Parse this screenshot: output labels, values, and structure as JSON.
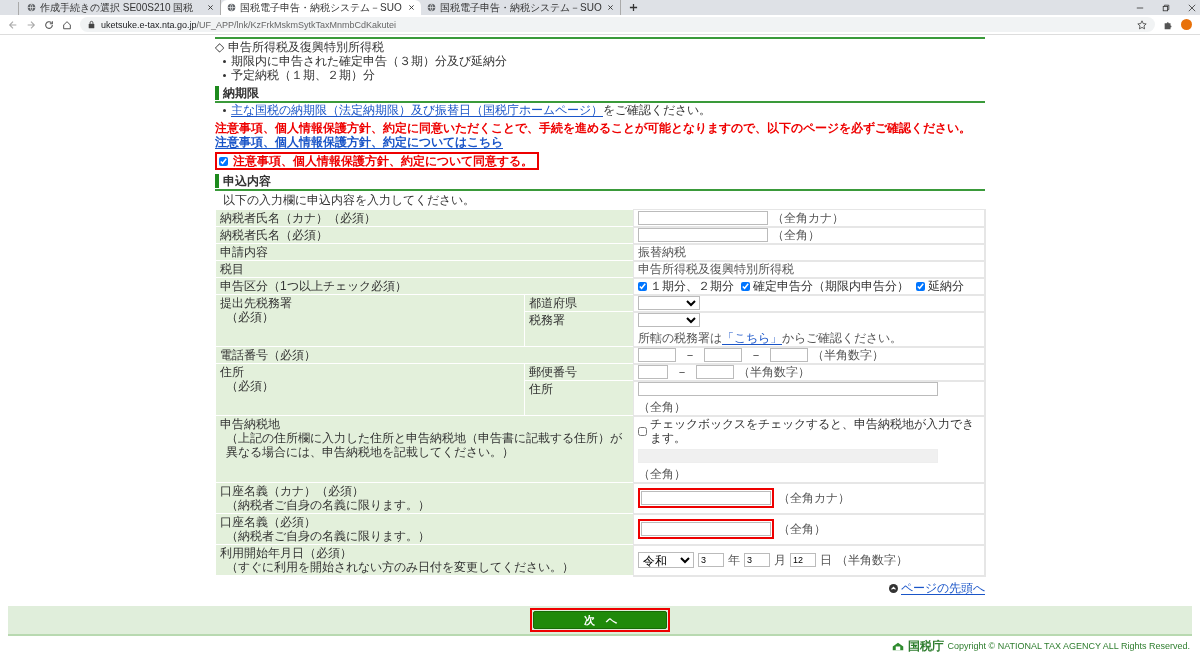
{
  "browser": {
    "tabs": [
      {
        "title": "作成手続きの選択 SE00S210 国税",
        "selected": false
      },
      {
        "title": "国税電子申告・納税システム－SUO",
        "selected": true
      },
      {
        "title": "国税電子申告・納税システム－SUO",
        "selected": false
      }
    ],
    "url": {
      "host": "uketsuke.e-tax.nta.go.jp",
      "path": "/UF_APP/lnk/KzFrkMskmSytkTaxMnmbCdKakutei"
    }
  },
  "tax_item": {
    "title": "◇ 申告所得税及復興特別所得税",
    "bullets": [
      "期限内に申告された確定申告（３期）分及び延納分",
      "予定納税（１期、２期）分"
    ]
  },
  "deadline": {
    "heading": "納期限",
    "link": "主な国税の納期限（法定納期限）及び振替日（国税庁ホームページ）",
    "after": "をご確認ください。"
  },
  "notice": {
    "text": "注意事項、個人情報保護方針、約定に同意いただくことで、手続を進めることが可能となりますので、以下のページを必ずご確認ください。",
    "link": "注意事項、個人情報保護方針、約定についてはこちら"
  },
  "agree": {
    "label": "注意事項、個人情報保護方針、約定について同意する。",
    "checked": true,
    "highlighted": true
  },
  "form": {
    "heading": "申込内容",
    "intro": "以下の入力欄に申込内容を入力してください。",
    "rows": [
      {
        "label": "納税者氏名（カナ）（必須）",
        "parts": [
          {
            "items": [
              {
                "kind": "text_field",
                "highlighted": false
              },
              {
                "kind": "note",
                "text": "（全角カナ）"
              }
            ]
          }
        ]
      },
      {
        "label": "納税者氏名（必須）",
        "parts": [
          {
            "items": [
              {
                "kind": "text_field",
                "highlighted": false
              },
              {
                "kind": "note",
                "text": "（全角）"
              }
            ]
          }
        ]
      },
      {
        "label": "申請内容",
        "parts": [
          {
            "items": [
              {
                "kind": "note",
                "text": "振替納税"
              }
            ]
          }
        ]
      },
      {
        "label": "税目",
        "parts": [
          {
            "items": [
              {
                "kind": "note",
                "text": "申告所得税及復興特別所得税"
              }
            ]
          }
        ]
      },
      {
        "label": "申告区分（1つ以上チェック必須）",
        "parts": [
          {
            "items": [
              {
                "kind": "checkbox",
                "checked": true,
                "text": "１期分、２期分"
              },
              {
                "kind": "checkbox",
                "checked": true,
                "text": "確定申告分（期限内申告分）"
              },
              {
                "kind": "checkbox",
                "checked": true,
                "text": "延納分"
              }
            ]
          }
        ]
      },
      {
        "label": "提出先税務署",
        "note": "（必須）",
        "parts": [
          {
            "sublabel": "都道府県",
            "items": [
              {
                "kind": "select"
              }
            ]
          },
          {
            "sublabel": "税務署",
            "items": [
              {
                "kind": "select"
              },
              {
                "kind": "break"
              },
              {
                "kind": "sentence",
                "before": "所轄の税務署は",
                "link": "「こちら」",
                "after": "からご確認ください。"
              }
            ]
          }
        ]
      },
      {
        "label": "電話番号（必須）",
        "parts": [
          {
            "items": [
              {
                "kind": "phone_field"
              },
              {
                "kind": "dash",
                "text": "－"
              },
              {
                "kind": "phone_field"
              },
              {
                "kind": "dash",
                "text": "－"
              },
              {
                "kind": "phone_field"
              },
              {
                "kind": "note",
                "text": "（半角数字）"
              }
            ]
          }
        ]
      },
      {
        "label": "住所",
        "note": "（必須）",
        "parts": [
          {
            "sublabel": "郵便番号",
            "items": [
              {
                "kind": "short_field"
              },
              {
                "kind": "dash",
                "text": "－"
              },
              {
                "kind": "phone_field"
              },
              {
                "kind": "note",
                "text": "（半角数字）"
              }
            ]
          },
          {
            "sublabel": "住所",
            "items": [
              {
                "kind": "wide_field",
                "disabled": false
              },
              {
                "kind": "break"
              },
              {
                "kind": "note",
                "text": "（全角）"
              }
            ]
          }
        ]
      },
      {
        "label": "申告納税地",
        "note": "（上記の住所欄に入力した住所と申告納税地（申告書に記載する住所）が異なる場合には、申告納税地を記載してください。）",
        "parts": [
          {
            "items": [
              {
                "kind": "checkbox",
                "checked": false,
                "text": "チェックボックスをチェックすると、申告納税地が入力できます。"
              },
              {
                "kind": "break"
              },
              {
                "kind": "wide_field",
                "disabled": true
              },
              {
                "kind": "break"
              },
              {
                "kind": "note",
                "text": "（全角）"
              }
            ]
          }
        ]
      },
      {
        "label": "口座名義（カナ）（必須）",
        "note": "（納税者ご自身の名義に限ります。）",
        "parts": [
          {
            "items": [
              {
                "kind": "text_field",
                "highlighted": true
              },
              {
                "kind": "note",
                "text": "（全角カナ）"
              }
            ]
          }
        ]
      },
      {
        "label": "口座名義（必須）",
        "note": "（納税者ご自身の名義に限ります。）",
        "parts": [
          {
            "items": [
              {
                "kind": "text_field",
                "highlighted": true
              },
              {
                "kind": "note",
                "text": "（全角）"
              }
            ]
          }
        ]
      },
      {
        "label": "利用開始年月日（必須）",
        "note": "（すぐに利用を開始されない方のみ日付を変更してください。）",
        "parts": [
          {
            "items": [
              {
                "kind": "era_select",
                "value": "令和"
              },
              {
                "kind": "date_field",
                "value": "3"
              },
              {
                "kind": "note",
                "text": "年"
              },
              {
                "kind": "date_field",
                "value": "3"
              },
              {
                "kind": "note",
                "text": "月"
              },
              {
                "kind": "date_field",
                "value": "12"
              },
              {
                "kind": "note",
                "text": "日"
              },
              {
                "kind": "note",
                "text": "（半角数字）"
              }
            ]
          }
        ]
      }
    ]
  },
  "page_top_link": "ページの先頭へ",
  "next_button": {
    "label": "次　へ",
    "highlighted": true
  },
  "footer": {
    "agency": "国税庁",
    "copyright": "Copyright © NATIONAL TAX AGENCY ALL Rights Reserved."
  }
}
